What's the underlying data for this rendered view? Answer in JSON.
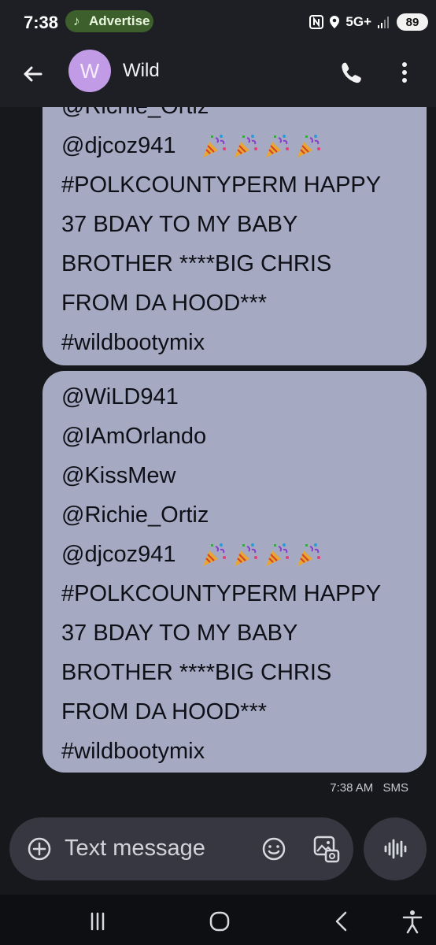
{
  "status_bar": {
    "time": "7:38",
    "notification_chip": "Advertise",
    "network": "5G+",
    "battery": "89"
  },
  "header": {
    "avatar_initial": "W",
    "contact_name": "Wild"
  },
  "messages": [
    {
      "lines": [
        "@Richie_Ortiz",
        "@djcoz941",
        "#POLKCOUNTYPERM HAPPY",
        "37 BDAY TO MY BABY",
        "BROTHER ****BIG CHRIS",
        "FROM DA HOOD***",
        "#wildbootymix"
      ]
    },
    {
      "lines": [
        "@WiLD941",
        "@IAmOrlando",
        "@KissMew",
        "@Richie_Ortiz",
        "@djcoz941",
        "#POLKCOUNTYPERM HAPPY",
        "37 BDAY TO MY BABY",
        "BROTHER ****BIG CHRIS",
        "FROM DA HOOD***",
        "#wildbootymix"
      ],
      "time": "7:38 AM",
      "type": "SMS"
    }
  ],
  "composer": {
    "placeholder": "Text message"
  },
  "icons": {
    "back": "arrow-left-icon",
    "call": "phone-icon",
    "more": "more-vert-icon",
    "add": "plus-circle-icon",
    "emoji": "smile-icon",
    "gallery": "gallery-icon",
    "voice": "voice-wave-icon",
    "recents": "recents-icon",
    "home": "home-icon",
    "back_nav": "back-chevron-icon",
    "accessibility": "accessibility-icon",
    "emoji_in_message": "party-popper"
  },
  "colors": {
    "background": "#17181c",
    "bubble": "#a5aac2",
    "avatar": "#c29be6"
  }
}
